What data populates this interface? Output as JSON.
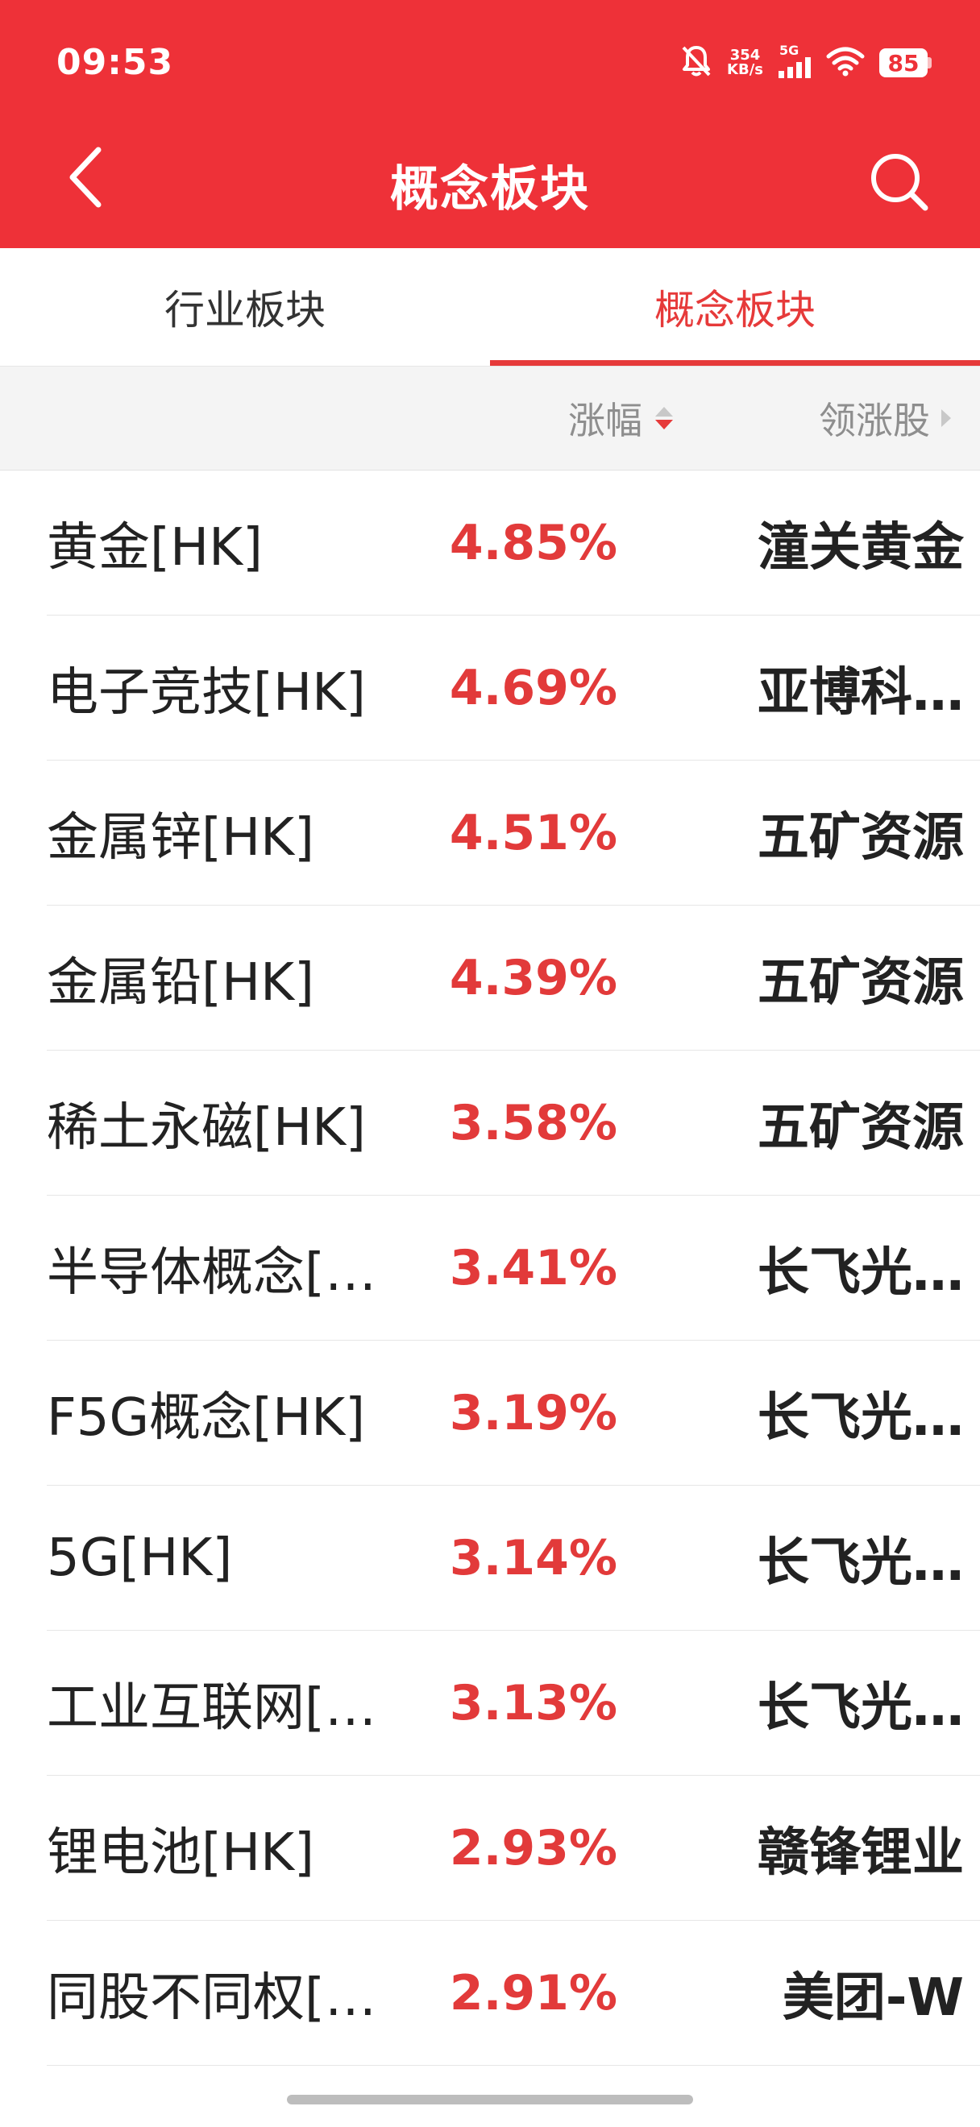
{
  "status_bar": {
    "time": "09:53",
    "net_speed_value": "354",
    "net_speed_unit": "KB/s",
    "signal_label": "5G",
    "battery": "85"
  },
  "header": {
    "title": "概念板块"
  },
  "tabs": [
    {
      "label": "行业板块",
      "active": false
    },
    {
      "label": "概念板块",
      "active": true
    }
  ],
  "columns": {
    "change": "涨幅",
    "leader": "领涨股"
  },
  "rows": [
    {
      "name": "黄金[HK]",
      "change": "4.85%",
      "leader": "潼关黄金"
    },
    {
      "name": "电子竞技[HK]",
      "change": "4.69%",
      "leader": "亚博科…"
    },
    {
      "name": "金属锌[HK]",
      "change": "4.51%",
      "leader": "五矿资源"
    },
    {
      "name": "金属铅[HK]",
      "change": "4.39%",
      "leader": "五矿资源"
    },
    {
      "name": "稀土永磁[HK]",
      "change": "3.58%",
      "leader": "五矿资源"
    },
    {
      "name": "半导体概念[…",
      "change": "3.41%",
      "leader": "长飞光…"
    },
    {
      "name": "F5G概念[HK]",
      "change": "3.19%",
      "leader": "长飞光…"
    },
    {
      "name": "5G[HK]",
      "change": "3.14%",
      "leader": "长飞光…"
    },
    {
      "name": "工业互联网[…",
      "change": "3.13%",
      "leader": "长飞光…"
    },
    {
      "name": "锂电池[HK]",
      "change": "2.93%",
      "leader": "赣锋锂业"
    },
    {
      "name": "同股不同权[…",
      "change": "2.91%",
      "leader": "美团-W"
    }
  ],
  "colors": {
    "brand_red": "#ee3138",
    "up_red": "#e23a3a"
  }
}
